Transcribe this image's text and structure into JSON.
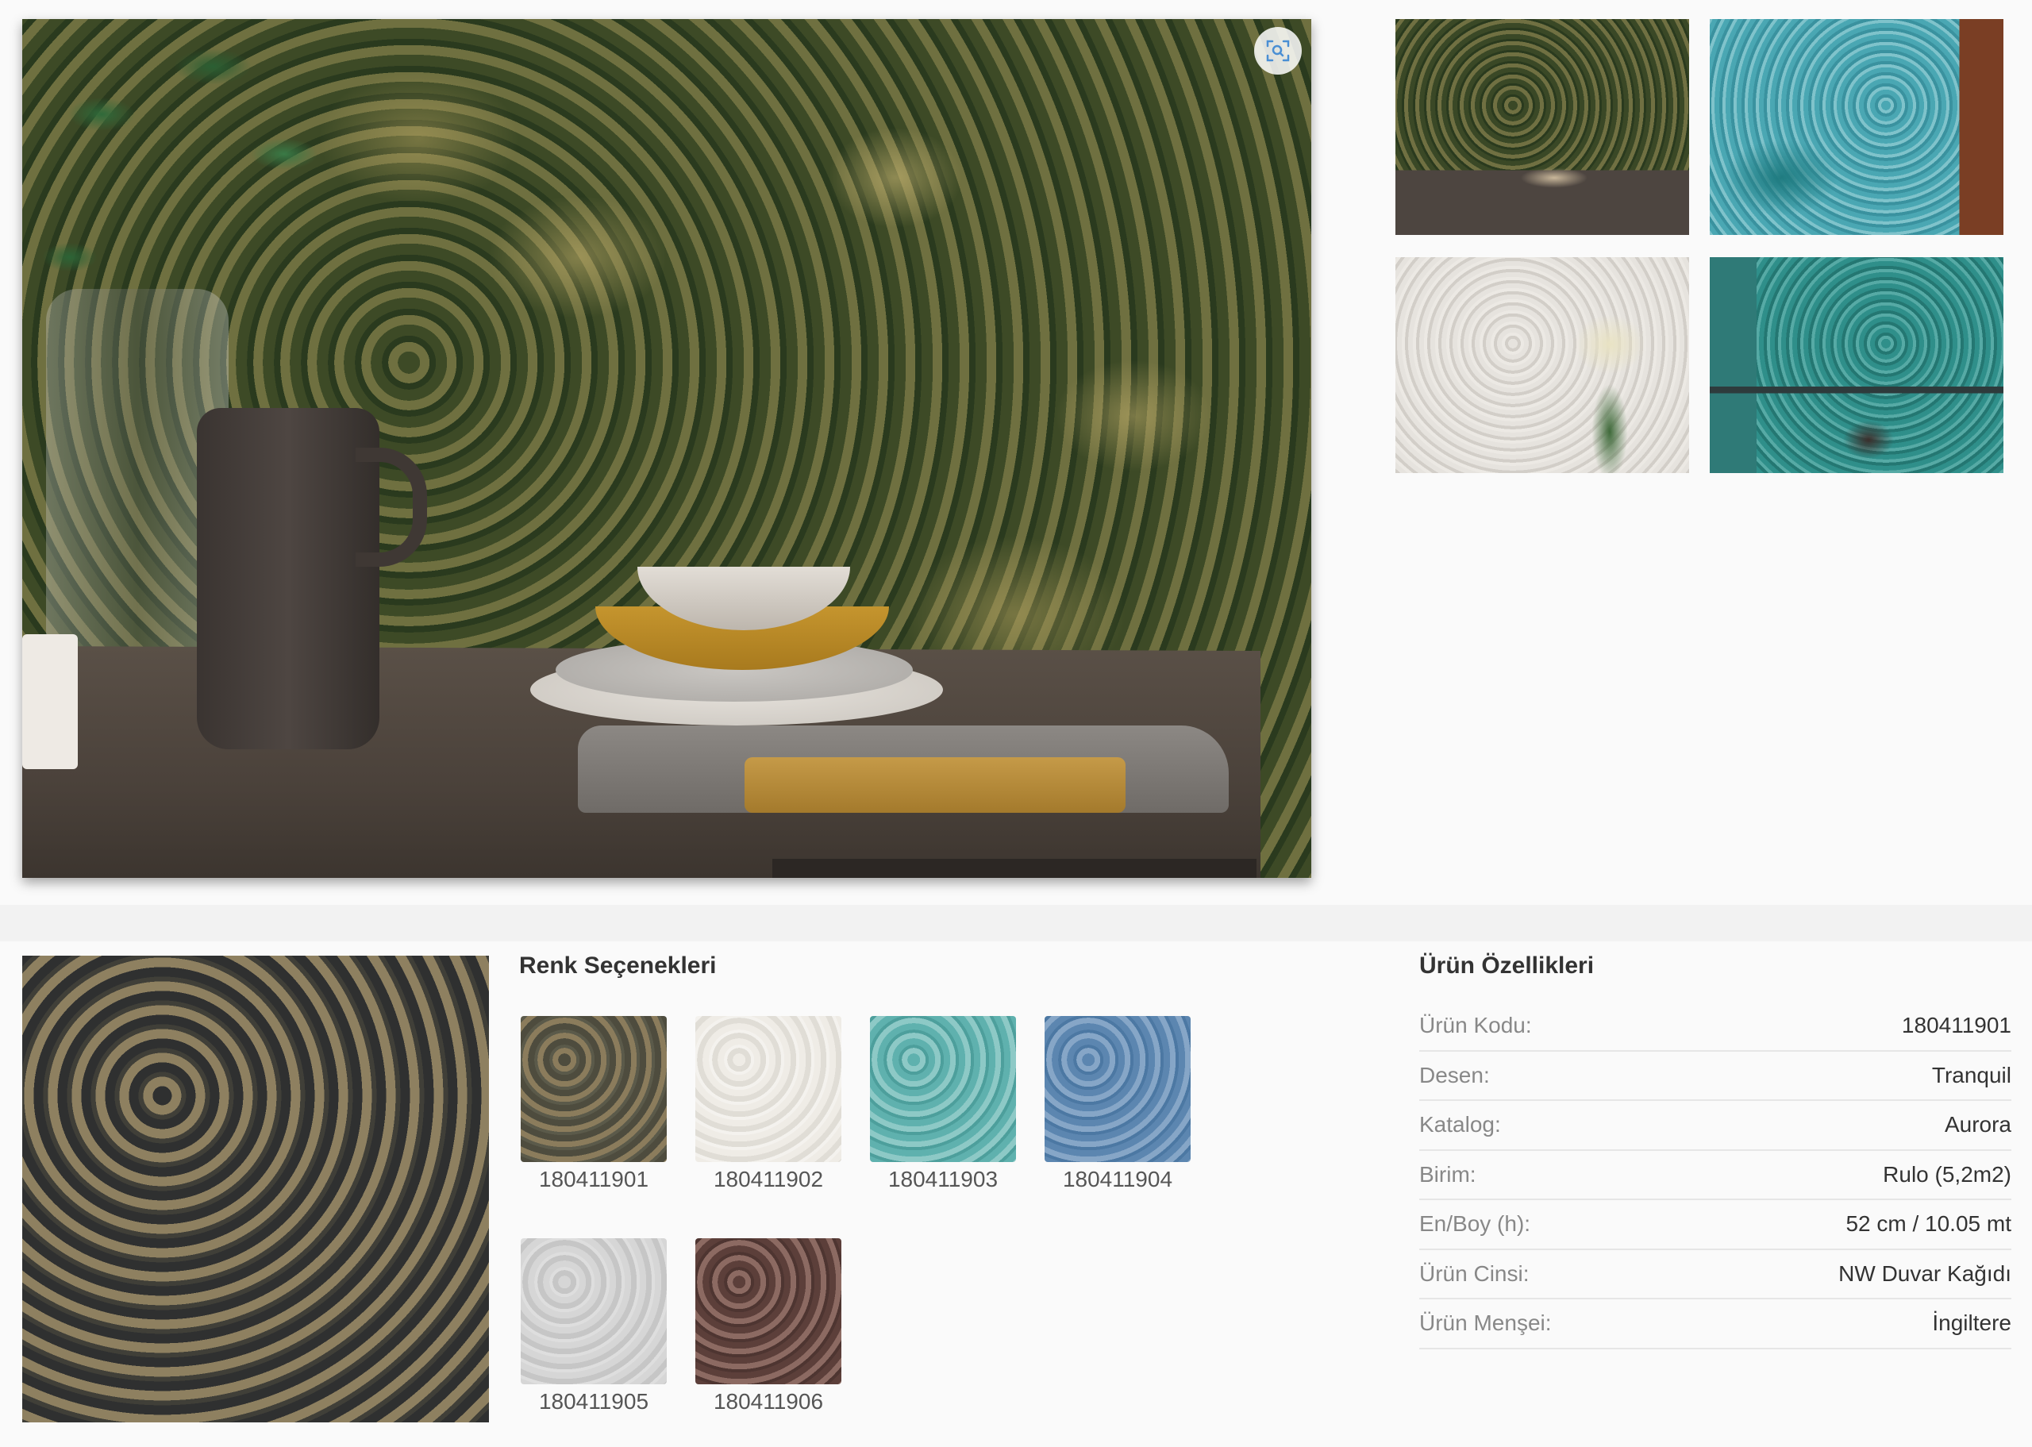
{
  "gallery": {
    "main_image_alt": "",
    "thumbnails": [
      "",
      "",
      "",
      ""
    ]
  },
  "colors": {
    "title": "Renk Seçenekleri",
    "items": [
      {
        "code": "180411901",
        "color": "#6e6650"
      },
      {
        "code": "180411902",
        "color": "#ece9e3"
      },
      {
        "code": "180411903",
        "color": "#6fb9b6"
      },
      {
        "code": "180411904",
        "color": "#6b90b8"
      },
      {
        "code": "180411905",
        "color": "#d4d4d4"
      },
      {
        "code": "180411906",
        "color": "#6e4e48"
      }
    ]
  },
  "specs": {
    "title": "Ürün Özellikleri",
    "rows": [
      {
        "label": "Ürün Kodu:",
        "value": "180411901"
      },
      {
        "label": "Desen:",
        "value": "Tranquil"
      },
      {
        "label": "Katalog:",
        "value": "Aurora"
      },
      {
        "label": "Birim:",
        "value": "Rulo (5,2m2)"
      },
      {
        "label": "En/Boy (h):",
        "value": "52 cm / 10.05 mt"
      },
      {
        "label": "Ürün Cinsi:",
        "value": "NW Duvar Kağıdı"
      },
      {
        "label": "Ürün Menşei:",
        "value": "İngiltere"
      }
    ]
  },
  "icons": {
    "zoom": "zoom-icon"
  }
}
